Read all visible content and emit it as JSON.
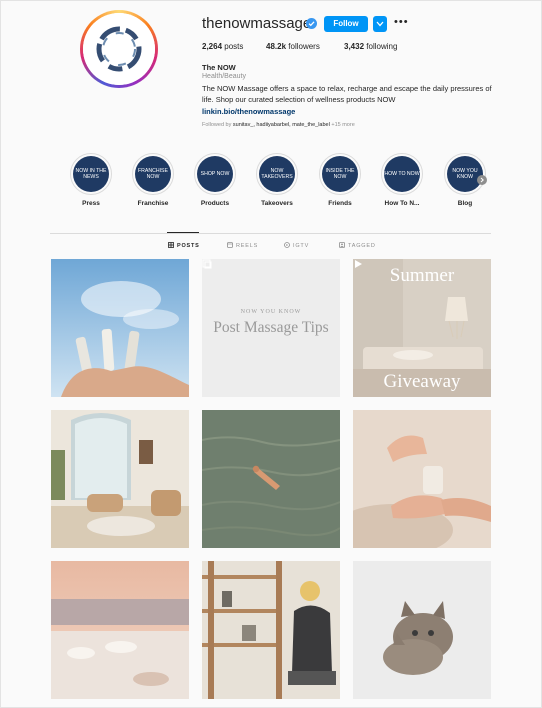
{
  "profile": {
    "username": "thenowmassage",
    "follow_label": "Follow",
    "stats": {
      "posts_count": "2,264",
      "posts_label": "posts",
      "followers_count": "48.2k",
      "followers_label": "followers",
      "following_count": "3,432",
      "following_label": "following"
    },
    "name": "The NOW",
    "category": "Health/Beauty",
    "bio": "The NOW Massage offers a space to relax, recharge and escape the daily pressures of life. Shop our curated selection of wellness products NOW",
    "link": "linkin.bio/thenowmassage",
    "followed_by_prefix": "Followed by",
    "followed_by_users": "sunitav_, hadiiyabarbel, mate_the_label",
    "followed_by_more": "+15 more"
  },
  "highlights": [
    {
      "circle": "NOW IN THE NEWS",
      "label": "Press"
    },
    {
      "circle": "FRANCHISE NOW",
      "label": "Franchise"
    },
    {
      "circle": "SHOP NOW",
      "label": "Products"
    },
    {
      "circle": "NOW TAKEOVERS",
      "label": "Takeovers"
    },
    {
      "circle": "INSIDE THE NOW",
      "label": "Friends"
    },
    {
      "circle": "HOW TO NOW",
      "label": "How To N..."
    },
    {
      "circle": "NOW YOU KNOW",
      "label": "Blog"
    }
  ],
  "tabs": {
    "posts": "POSTS",
    "reels": "REELS",
    "igtv": "IGTV",
    "tagged": "TAGGED"
  },
  "posts": {
    "tip_small": "NOW YOU KNOW",
    "tip_big": "Post Massage Tips",
    "giveaway_top": "Summer",
    "giveaway_bottom": "Giveaway"
  },
  "colors": {
    "accent": "#0095f6",
    "highlight_circle": "#1f3a63",
    "link": "#00376b"
  },
  "icons": [
    "verified-badge-icon",
    "chevron-down-icon",
    "more-options-icon",
    "grid-icon",
    "reels-icon",
    "igtv-icon",
    "tagged-icon",
    "next-arrow-icon"
  ]
}
